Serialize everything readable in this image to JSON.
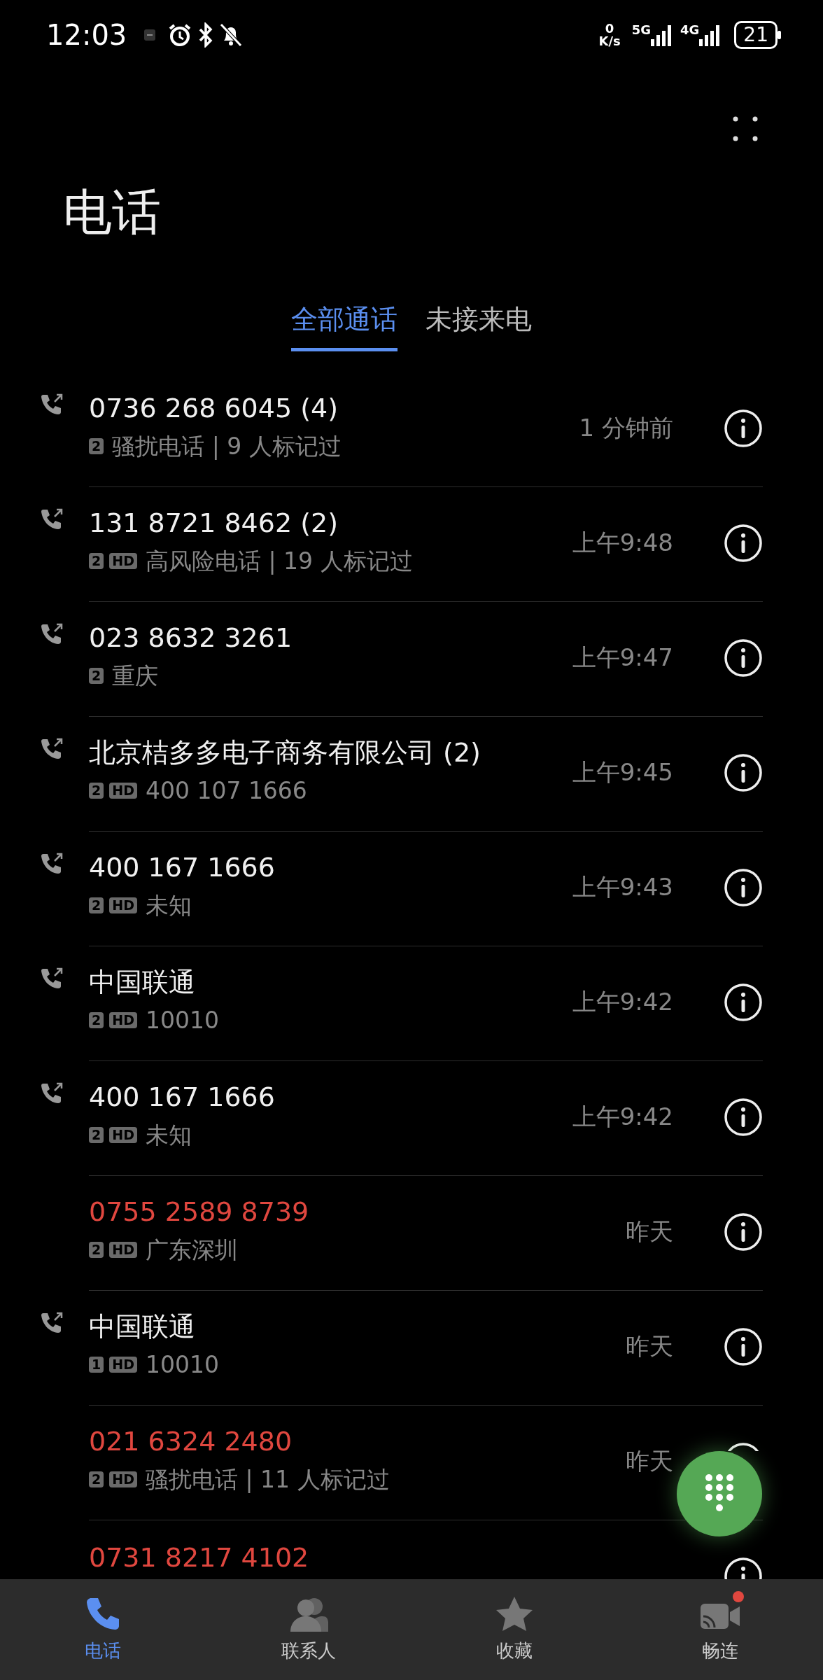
{
  "status_bar": {
    "time": "12:03",
    "net_speed_value": "0",
    "net_speed_unit": "K/s",
    "sim1_network": "5G",
    "sim2_network": "4G",
    "battery": "21"
  },
  "title": "电话",
  "tabs": [
    {
      "label": "全部通话",
      "selected": true
    },
    {
      "label": "未接来电",
      "selected": false
    }
  ],
  "calls": [
    {
      "name": "0736 268 6045 (4)",
      "missed": false,
      "tags": [
        "2"
      ],
      "detail": "骚扰电话 | 9 人标记过",
      "time": "1 分钟前"
    },
    {
      "name": "131 8721 8462 (2)",
      "missed": false,
      "tags": [
        "2",
        "HD"
      ],
      "detail": "高风险电话 | 19 人标记过",
      "time": "上午9:48"
    },
    {
      "name": "023 8632 3261",
      "missed": false,
      "tags": [
        "2"
      ],
      "detail": "重庆",
      "time": "上午9:47"
    },
    {
      "name": "北京桔多多电子商务有限公司 (2)",
      "missed": false,
      "tags": [
        "2",
        "HD"
      ],
      "detail": "400 107 1666",
      "time": "上午9:45"
    },
    {
      "name": "400 167 1666",
      "missed": false,
      "tags": [
        "2",
        "HD"
      ],
      "detail": "未知",
      "time": "上午9:43"
    },
    {
      "name": "中国联通",
      "missed": false,
      "tags": [
        "2",
        "HD"
      ],
      "detail": "10010",
      "time": "上午9:42"
    },
    {
      "name": "400 167 1666",
      "missed": false,
      "tags": [
        "2",
        "HD"
      ],
      "detail": "未知",
      "time": "上午9:42"
    },
    {
      "name": "0755 2589 8739",
      "missed": true,
      "tags": [
        "2",
        "HD"
      ],
      "detail": "广东深圳",
      "time": "昨天"
    },
    {
      "name": "中国联通",
      "missed": false,
      "tags": [
        "1",
        "HD"
      ],
      "detail": "10010",
      "time": "昨天"
    },
    {
      "name": "021 6324 2480",
      "missed": true,
      "tags": [
        "2",
        "HD"
      ],
      "detail": "骚扰电话 | 11 人标记过",
      "time": "昨天"
    },
    {
      "name": "0731 8217 4102",
      "missed": true
    }
  ],
  "bottom_nav": [
    {
      "kind": "phone",
      "label": "电话",
      "selected": true,
      "notification_dot": false
    },
    {
      "kind": "contacts",
      "label": "联系人",
      "selected": false,
      "notification_dot": false
    },
    {
      "kind": "favorites",
      "label": "收藏",
      "selected": false,
      "notification_dot": false
    },
    {
      "kind": "meetime",
      "label": "畅连",
      "selected": false,
      "notification_dot": true
    }
  ]
}
